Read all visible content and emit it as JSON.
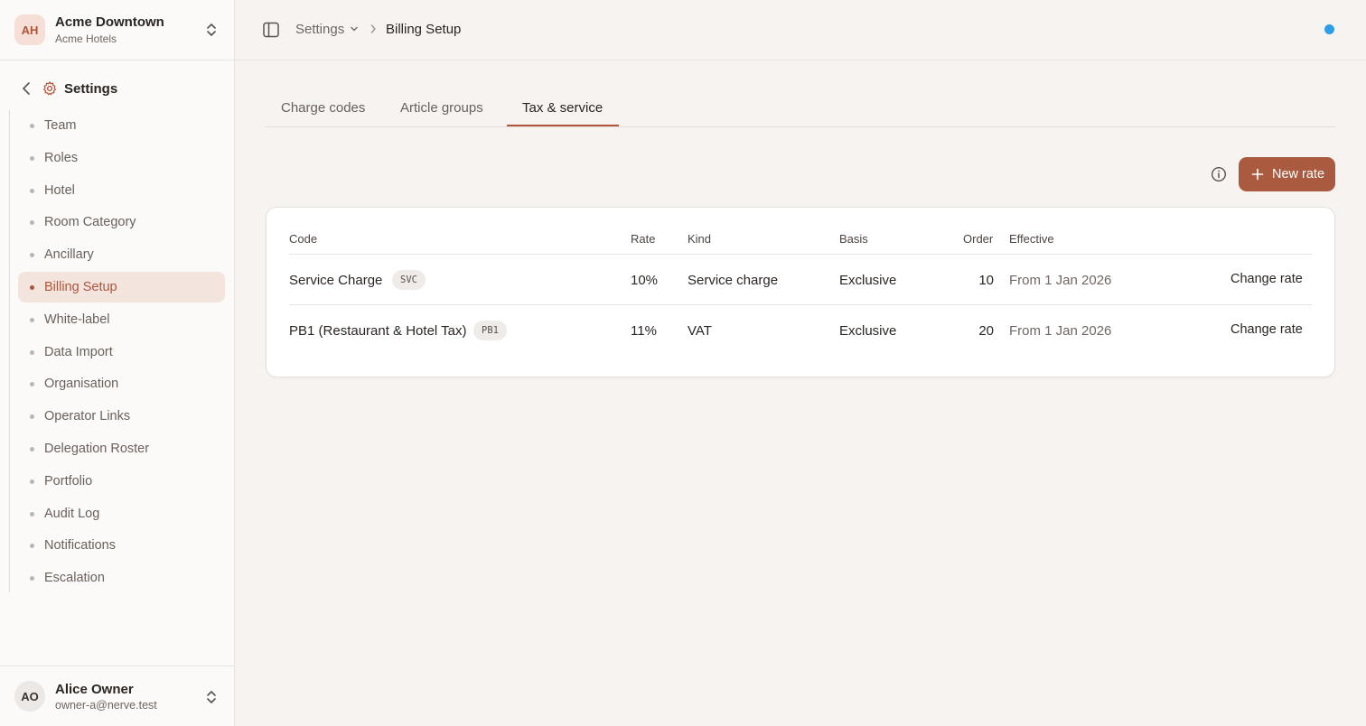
{
  "org": {
    "initials": "AH",
    "name": "Acme Downtown",
    "sub": "Acme Hotels"
  },
  "settings": {
    "title": "Settings"
  },
  "nav": {
    "items": [
      {
        "label": "Team",
        "active": false
      },
      {
        "label": "Roles",
        "active": false
      },
      {
        "label": "Hotel",
        "active": false
      },
      {
        "label": "Room Category",
        "active": false
      },
      {
        "label": "Ancillary",
        "active": false
      },
      {
        "label": "Billing Setup",
        "active": true
      },
      {
        "label": "White-label",
        "active": false
      },
      {
        "label": "Data Import",
        "active": false
      },
      {
        "label": "Organisation",
        "active": false
      },
      {
        "label": "Operator Links",
        "active": false
      },
      {
        "label": "Delegation Roster",
        "active": false
      },
      {
        "label": "Portfolio",
        "active": false
      },
      {
        "label": "Audit Log",
        "active": false
      },
      {
        "label": "Notifications",
        "active": false
      },
      {
        "label": "Escalation",
        "active": false
      }
    ]
  },
  "user": {
    "initials": "AO",
    "name": "Alice Owner",
    "email": "owner-a@nerve.test"
  },
  "breadcrumb": {
    "parent": "Settings",
    "current": "Billing Setup"
  },
  "tabs": [
    {
      "label": "Charge codes",
      "active": false
    },
    {
      "label": "Article groups",
      "active": false
    },
    {
      "label": "Tax & service",
      "active": true
    }
  ],
  "actions": {
    "new_rate": "New rate"
  },
  "table": {
    "headers": {
      "code": "Code",
      "rate": "Rate",
      "kind": "Kind",
      "basis": "Basis",
      "order": "Order",
      "effective": "Effective"
    },
    "rows": [
      {
        "name": "Service Charge",
        "badge": "SVC",
        "rate": "10%",
        "kind": "Service charge",
        "basis": "Exclusive",
        "order": "10",
        "effective": "From 1 Jan 2026",
        "action": "Change rate"
      },
      {
        "name": "PB1 (Restaurant & Hotel Tax)",
        "badge": "PB1",
        "rate": "11%",
        "kind": "VAT",
        "basis": "Exclusive",
        "order": "20",
        "effective": "From 1 Jan 2026",
        "action": "Change rate"
      }
    ]
  },
  "colors": {
    "accent": "#b0543a",
    "button": "#a95a3f",
    "status_dot": "#2d9ee6"
  }
}
